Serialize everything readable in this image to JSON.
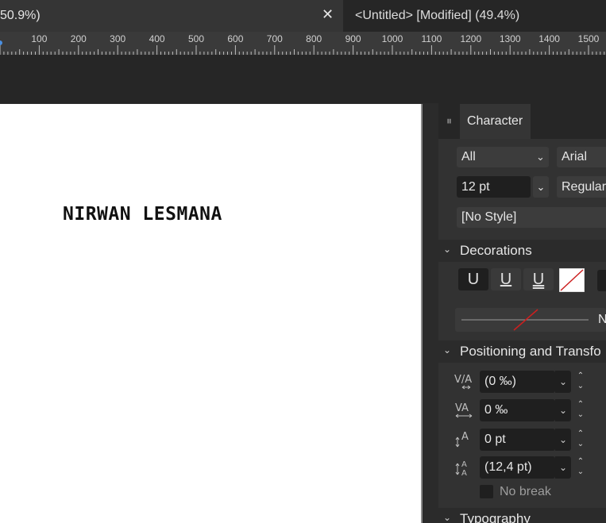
{
  "tabs": [
    {
      "label": "50.9%)",
      "close": "✕"
    },
    {
      "label": "<Untitled> [Modified] (49.4%)"
    }
  ],
  "ruler": {
    "ticks": [
      "100",
      "200",
      "300",
      "400",
      "500",
      "600",
      "700",
      "800",
      "900",
      "1000",
      "1100",
      "1200",
      "1300",
      "1400",
      "1500"
    ]
  },
  "artwork": {
    "text": "NIRWAN LESMANA"
  },
  "panel": {
    "title": "Character",
    "selector": "All",
    "font_family": "Arial",
    "font_size": "12 pt",
    "font_style": "Regular",
    "text_style": "[No Style]",
    "sections": {
      "decorations": "Decorations",
      "positioning": "Positioning and Transfo",
      "typography": "Typography"
    },
    "decorations": {
      "buttons": [
        "U",
        "U",
        "U"
      ],
      "line_label": "N"
    },
    "positioning": {
      "kerning": "(0 ‰)",
      "tracking": "0 ‰",
      "baseline": "0 pt",
      "leading": "(12,4 pt)",
      "no_break": "No break"
    }
  },
  "colors": {
    "accent_red": "#cc1f1f",
    "panel_bg": "#323232",
    "field_bg": "#1f1f1f"
  }
}
